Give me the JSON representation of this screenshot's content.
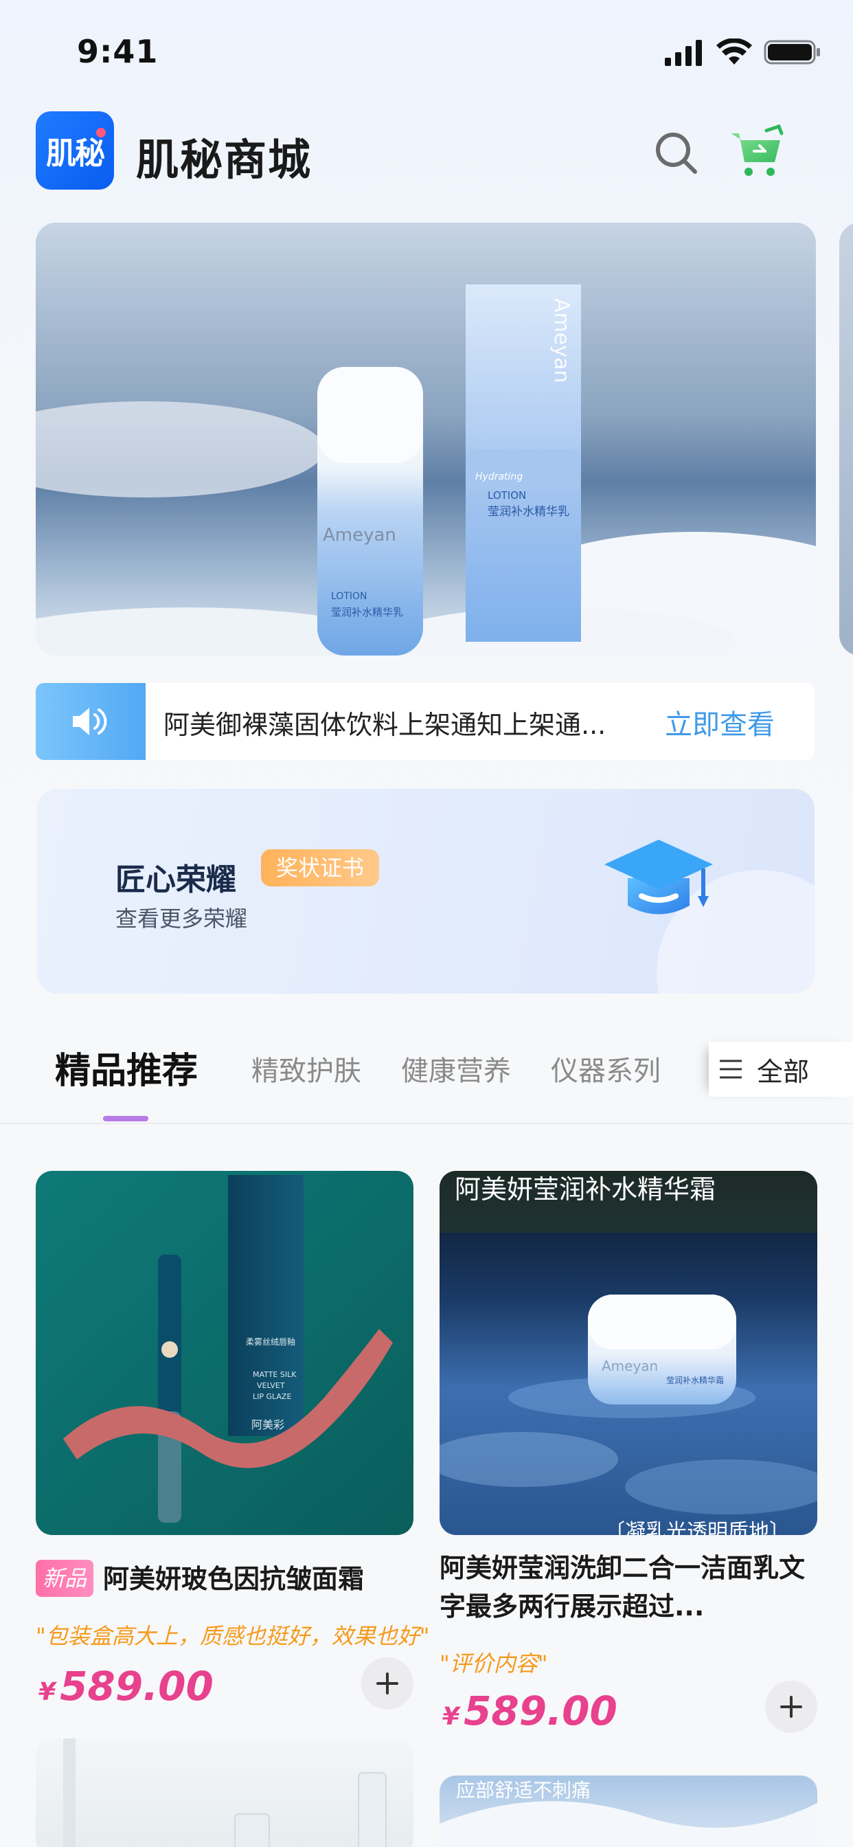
{
  "status_bar": {
    "time": "9:41"
  },
  "header": {
    "logo_text": "肌秘",
    "title": "肌秘商城"
  },
  "banner": {
    "product_brand": "Ameyan",
    "product_label_en": "LOTION",
    "product_label_cn": "莹润补水精华乳",
    "product_script": "Hydrating"
  },
  "notice": {
    "text": "阿美御裸藻固体饮料上架通知上架通...",
    "link": "立即查看"
  },
  "honor": {
    "title": "匠心荣耀",
    "badge": "奖状证书",
    "subtitle": "查看更多荣耀"
  },
  "tabs": {
    "items": [
      {
        "label": "精品推荐",
        "active": true
      },
      {
        "label": "精致护肤",
        "active": false
      },
      {
        "label": "健康营养",
        "active": false
      },
      {
        "label": "仪器系列",
        "active": false
      }
    ],
    "all_label": "全部"
  },
  "products": [
    {
      "tag": "新品",
      "name": "阿美妍玻色因抗皱面霜",
      "review": "\"包装盒高大上，质感也挺好，效果也好\"",
      "currency": "¥",
      "price": "589.00",
      "image_text": {
        "box_line1": "柔雾丝绒唇釉",
        "box_line2": "MATTE SILK",
        "box_line3": "VELVET",
        "box_line4": "LIP GLAZE",
        "box_line5": "阿美彩"
      }
    },
    {
      "name": "阿美妍莹润洗卸二合一洁面乳文字最多两行展示超过...",
      "review": "\"评价内容\"",
      "currency": "¥",
      "price": "589.00",
      "image_text": {
        "top": "阿美妍莹润补水精华霜",
        "bottom": "〔凝乳光透明质地〕",
        "jar_brand": "Ameyan",
        "jar_label": "莹润补水精华霜"
      }
    }
  ],
  "next_row": {
    "right_image_text": "应部舒适不刺痛"
  }
}
